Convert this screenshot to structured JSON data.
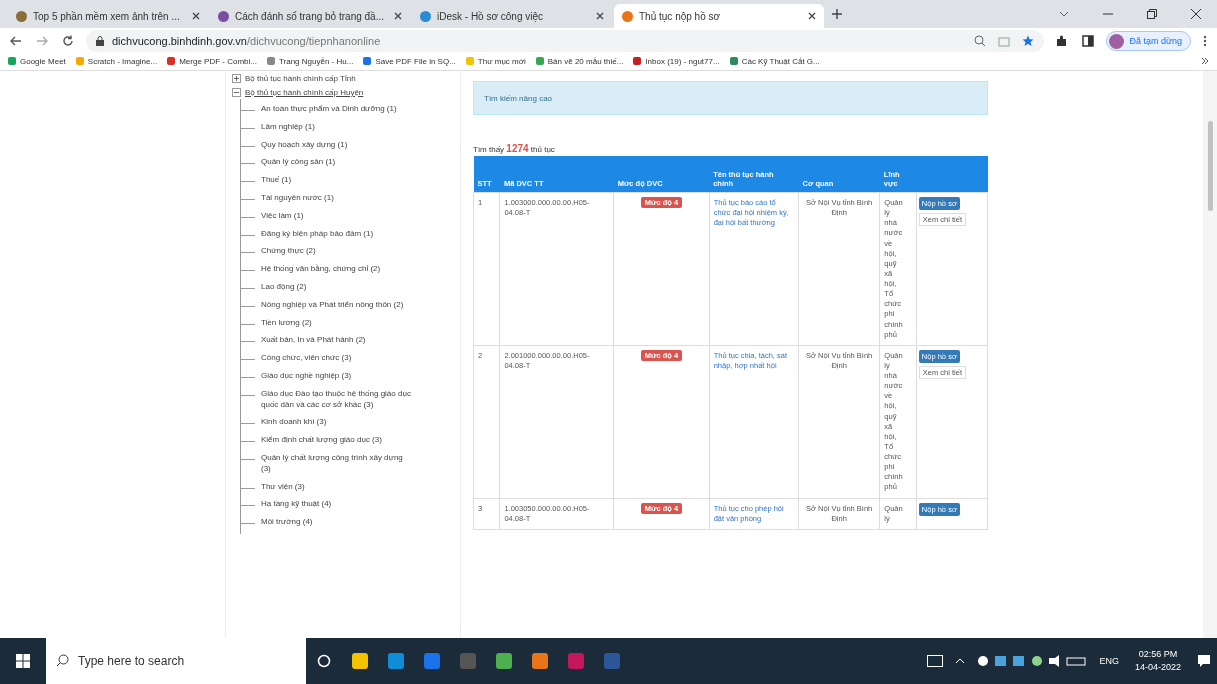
{
  "browser": {
    "tabs": [
      {
        "title": "Top 5 phần mềm xem ảnh trên ...",
        "selected": false
      },
      {
        "title": "Cách đánh số trang bỏ trang đầ...",
        "selected": false
      },
      {
        "title": "iDesk - Hồ sơ công việc",
        "selected": false
      },
      {
        "title": "Thủ tục nộp hồ sơ",
        "selected": true
      }
    ],
    "address": {
      "host": "dichvucong.binhdinh.gov.vn",
      "path": "/dichvucong/tiepnhanonline"
    },
    "profile": "Đã tạm dừng",
    "bookmarks": [
      "Google Meet",
      "Scratch - Imagine...",
      "Merge PDF - Combi...",
      "Trang Nguyễn - Hu...",
      "Save PDF File in SQ...",
      "Thư mục mới",
      "Bản vẽ 20 mẫu thiế...",
      "Inbox (19) - ngut77...",
      "Các Kỹ Thuật Cắt G..."
    ]
  },
  "tree": [
    {
      "label": "Bộ thủ tục hành chính cấp Tỉnh",
      "expanded": false
    },
    {
      "label": "Bộ thủ tục hành chính cấp Huyện",
      "expanded": true,
      "children": [
        {
          "label": "An toàn thực phẩm và Dinh dưỡng (1)"
        },
        {
          "label": "Lâm nghiệp (1)"
        },
        {
          "label": "Quy hoạch xây dựng (1)"
        },
        {
          "label": "Quản lý công sản (1)"
        },
        {
          "label": "Thuế (1)"
        },
        {
          "label": "Tài nguyên nước (1)"
        },
        {
          "label": "Việc làm (1)"
        },
        {
          "label": "Đăng ký biện pháp bảo đảm (1)"
        },
        {
          "label": "Chứng thực (2)"
        },
        {
          "label": "Hệ thống văn bằng, chứng chỉ (2)"
        },
        {
          "label": "Lao động (2)"
        },
        {
          "label": "Nông nghiệp và Phát triển nông thôn (2)"
        },
        {
          "label": "Tiền lương (2)"
        },
        {
          "label": "Xuất bản, In và Phát hành (2)"
        },
        {
          "label": "Công chức, viên chức (3)"
        },
        {
          "label": "Giáo dục nghề nghiệp (3)"
        },
        {
          "label": "Giáo dục Đào tạo thuộc hệ thống giáo dục quốc dân và các cơ sở khác (3)"
        },
        {
          "label": "Kinh doanh khí (3)"
        },
        {
          "label": "Kiểm định chất lượng giáo dục (3)"
        },
        {
          "label": "Quản lý chất lượng công trình xây dựng (3)"
        },
        {
          "label": "Thư viện (3)"
        },
        {
          "label": "Hạ tầng kỹ thuật (4)"
        },
        {
          "label": "Môi trường (4)"
        }
      ]
    }
  ],
  "search_panel": {
    "title": "Tìm kiếm nâng cao"
  },
  "result": {
    "prefix": "Tìm thấy",
    "count": "1274",
    "suffix": "thủ tục"
  },
  "table": {
    "columns": [
      "STT",
      "Mã DVC TT",
      "Mức độ DVC",
      "Tên thủ tục hành chính",
      "Cơ quan",
      "Lĩnh vực"
    ],
    "rows": [
      {
        "stt": "1",
        "code": "1.003000.000.00.00.H05-04.08-T",
        "level": "Mức độ 4",
        "name": "Thủ tục báo cáo tổ chức đại hội nhiệm kỳ, đại hội bất thường",
        "agency": "Sở Nội Vụ tỉnh Bình Định",
        "field": "Quản lý nhà nước về hội, quỹ xã hội, Tổ chức phi chính phủ",
        "submit": "Nộp hồ sơ",
        "detail": "Xem chi tiết"
      },
      {
        "stt": "2",
        "code": "2.001000.000.00.00.H05-04.08-T",
        "level": "Mức độ 4",
        "name": "Thủ tục chia, tách, sát nhập, hợp nhất hội",
        "agency": "Sở Nội Vụ tỉnh Bình Định",
        "field": "Quản lý nhà nước về hội, quỹ xã hội, Tổ chức phi chính phủ",
        "submit": "Nộp hồ sơ",
        "detail": "Xem chi tiết"
      },
      {
        "stt": "3",
        "code": "1.003050.000.00.00.H05-04.08-T",
        "level": "Mức độ 4",
        "name": "Thủ tục cho phép hội đặt văn phòng",
        "agency": "Sở Nội Vụ tỉnh Bình Định",
        "field": "Quản lý",
        "submit": "Nộp hồ sơ"
      }
    ]
  },
  "taskbar": {
    "search_placeholder": "Type here to search",
    "language": "ENG",
    "time": "02:56 PM",
    "date": "14-04-2022"
  }
}
